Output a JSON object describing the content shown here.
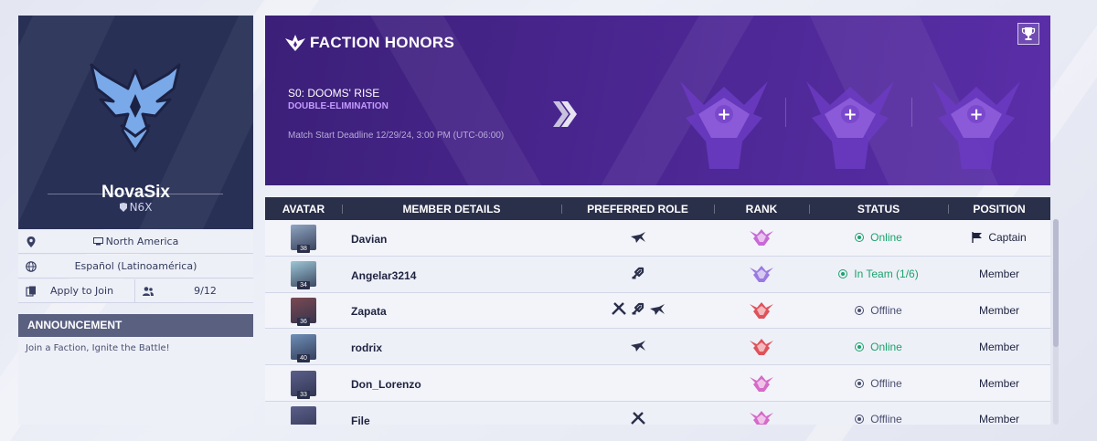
{
  "profile": {
    "name": "NovaSix",
    "tag": "N6X",
    "region": "North America",
    "language": "Español (Latinoamérica)",
    "join_label": "Apply to Join",
    "members_count": "9/12",
    "logo_color": "#7aa9ea"
  },
  "announcement": {
    "title": "ANNOUNCEMENT",
    "text": "Join a Faction, Ignite the Battle!"
  },
  "honors": {
    "title": "FACTION HONORS",
    "season": "S0: DOOMS' RISE",
    "format": "DOUBLE-ELIMINATION",
    "deadline": "Match Start Deadline 12/29/24, 3:00 PM (UTC-06:00)",
    "slots": [
      "+",
      "+",
      "+"
    ]
  },
  "table": {
    "headers": {
      "avatar": "AVATAR",
      "details": "MEMBER DETAILS",
      "role": "PREFERRED ROLE",
      "rank": "RANK",
      "status": "STATUS",
      "position": "POSITION"
    },
    "rows": [
      {
        "name": "Davian",
        "level": "38",
        "roles": [
          "duelist-icon"
        ],
        "rank_color": "#c86ad6",
        "status": "Online",
        "status_color": "#1aa36b",
        "position": "Captain",
        "captain": true,
        "avatar_color": "#8fa6c2"
      },
      {
        "name": "Angelar3214",
        "level": "34",
        "roles": [
          "strategist-icon"
        ],
        "rank_color": "#9a7ae0",
        "status": "In Team (1/6)",
        "status_color": "#1aa36b",
        "position": "Member",
        "captain": false,
        "avatar_color": "#9cc7d6"
      },
      {
        "name": "Zapata",
        "level": "36",
        "roles": [
          "vanguard-icon",
          "strategist-icon",
          "duelist-icon"
        ],
        "rank_color": "#e0525a",
        "status": "Offline",
        "status_color": "#4a4f70",
        "position": "Member",
        "captain": false,
        "avatar_color": "#7a4a52"
      },
      {
        "name": "rodrix",
        "level": "40",
        "roles": [
          "duelist-icon"
        ],
        "rank_color": "#e0525a",
        "status": "Online",
        "status_color": "#1aa36b",
        "position": "Member",
        "captain": false,
        "avatar_color": "#6e8fb8"
      },
      {
        "name": "Don_Lorenzo",
        "level": "33",
        "roles": [],
        "rank_color": "#d66ac8",
        "status": "Offline",
        "status_color": "#4a4f70",
        "position": "Member",
        "captain": false,
        "avatar_color": "#5b5f8a"
      },
      {
        "name": "File",
        "level": "",
        "roles": [
          "vanguard-icon"
        ],
        "rank_color": "#d66ac8",
        "status": "Offline",
        "status_color": "#4a4f70",
        "position": "Member",
        "captain": false,
        "avatar_color": "#5b5f8a"
      }
    ]
  }
}
